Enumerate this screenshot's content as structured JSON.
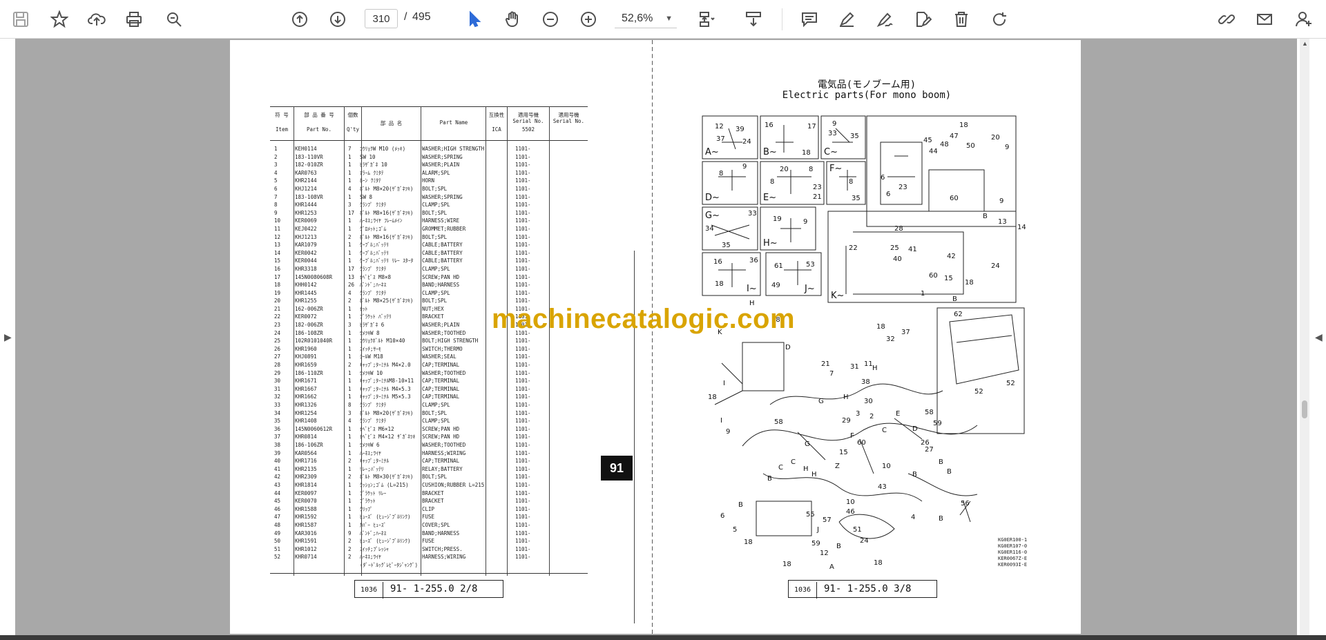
{
  "toolbar": {
    "page_current": "310",
    "page_separator": "/",
    "page_total": "495",
    "zoom": "52,6%"
  },
  "watermark": "machinecatalogic.com",
  "left_page": {
    "badge": "91",
    "footer_code": "1036",
    "footer_text": "91- 1-255.0   2/8",
    "headers": {
      "item_jp": "符 号",
      "item_en": "Item",
      "partno_jp": "部 品 番 号",
      "partno_en": "Part No.",
      "qty_jp": "個数",
      "qty_en": "Q'ty",
      "name_jp": "部 品 名",
      "name_en": "Part Name",
      "ica_jp": "互換性",
      "ica_en": "ICA",
      "serial1_jp": "適用号機",
      "serial1_en": "Serial No.",
      "serial1_val": "5502",
      "serial2_jp": "適用号機",
      "serial2_en": "Serial No."
    },
    "rows": [
      [
        "1",
        "KEH0114",
        "7",
        "ｺｳﾘｮｸW M10 (ﾒｯｷ)",
        "WASHER;HIGH STRENGTH",
        "1101-"
      ],
      [
        "2",
        "183-110VR",
        "1",
        "SW 10",
        "WASHER;SPRING",
        "1101-"
      ],
      [
        "3",
        "182-010ZR",
        "1",
        "ﾋﾗｻﾞｶﾞﾈ 10",
        "WASHER;PLAIN",
        "1101-"
      ],
      [
        "4",
        "KAR0763",
        "1",
        "ｱﾗｰﾑ ｸﾐﾀﾃ",
        "ALARM;SPL",
        "1101-"
      ],
      [
        "5",
        "KHR2144",
        "1",
        "ﾎｰﾝ ｸﾐﾀﾃ",
        "HORN",
        "1101-"
      ],
      [
        "6",
        "KHJ1214",
        "4",
        "ﾎﾞﾙﾄ M8×20(ｻﾞｶﾞﾈﾂｷ)",
        "BOLT;SPL",
        "1101-"
      ],
      [
        "7",
        "183-108VR",
        "1",
        "SW 8",
        "WASHER;SPRING",
        "1101-"
      ],
      [
        "8",
        "KHR1444",
        "3",
        "ｸﾗﾝﾌﾟ ｸﾐﾀﾃ",
        "CLAMP;SPL",
        "1101-"
      ],
      [
        "9",
        "KHR1253",
        "17",
        "ﾎﾞﾙﾄ M8×16(ｻﾞｶﾞﾈﾂｷ)",
        "BOLT;SPL",
        "1101-"
      ],
      [
        "10",
        "KER0069",
        "1",
        "ﾊｰﾈｽ;ﾜｲﾔ ﾌﾚｰﾑﾒｲﾝ",
        "HARNESS;WIRE",
        "1101-"
      ],
      [
        "11",
        "KEJ0422",
        "1",
        "ｸﾞﾛﾒｯﾄ;ｺﾞﾑ",
        "GROMMET;RUBBER",
        "1101-"
      ],
      [
        "12",
        "KHJ1213",
        "2",
        "ﾎﾞﾙﾄ M8×16(ｻﾞｶﾞﾈﾂｷ)",
        "BOLT;SPL",
        "1101-"
      ],
      [
        "13",
        "KAR1079",
        "1",
        "ｹｰﾌﾞﾙ;ﾊﾞｯﾃﾘ",
        "CABLE;BATTERY",
        "1101-"
      ],
      [
        "14",
        "KER0042",
        "1",
        "ｹｰﾌﾞﾙ;ﾊﾞｯﾃﾘ",
        "CABLE;BATTERY",
        "1101-"
      ],
      [
        "15",
        "KER0044",
        "1",
        "ｹｰﾌﾞﾙ;ﾊﾞｯﾃﾘ ﾘﾚｰ ｽﾀｰﾀ",
        "CABLE;BATTERY",
        "1101-"
      ],
      [
        "16",
        "KHR3318",
        "17",
        "ｸﾗﾝﾌﾟ ｸﾐﾀﾃ",
        "CLAMP;SPL",
        "1101-"
      ],
      [
        "17",
        "145N0080608R",
        "13",
        "ﾅﾍﾞﾋﾞｽ M8×8",
        "SCREW;PAN HD",
        "1101-"
      ],
      [
        "18",
        "KHH0142",
        "26",
        "ﾊﾞﾝﾄﾞ;ﾊｰﾈｽ",
        "BAND;HARNESS",
        "1101-"
      ],
      [
        "19",
        "KHR1445",
        "4",
        "ｸﾗﾝﾌﾟ ｸﾐﾀﾃ",
        "CLAMP;SPL",
        "1101-"
      ],
      [
        "20",
        "KHR1255",
        "2",
        "ﾎﾞﾙﾄ M8×25(ｻﾞｶﾞﾈﾂｷ)",
        "BOLT;SPL",
        "1101-"
      ],
      [
        "21",
        "162-006ZR",
        "1",
        "ﾅｯﾄ",
        "NUT;HEX",
        "1101-"
      ],
      [
        "22",
        "KER0072",
        "1",
        "ﾌﾞﾗｹｯﾄ ﾊﾞｯﾃﾘ",
        "BRACKET",
        "1101-"
      ],
      [
        "23",
        "182-006ZR",
        "3",
        "ﾋﾗｻﾞｶﾞﾈ 6",
        "WASHER;PLAIN",
        "1101-"
      ],
      [
        "24",
        "186-108ZR",
        "1",
        "ﾂﾒﾂｷW 8",
        "WASHER;TOOTHED",
        "1101-"
      ],
      [
        "25",
        "102R0101040R",
        "1",
        "ｺｳﾘｮｸﾎﾞﾙﾄ M10×40",
        "BOLT;HIGH STRENGTH",
        "1101-"
      ],
      [
        "26",
        "KHR1960",
        "1",
        "ｽｲｯﾁ;ｻｰﾓ",
        "SWITCH;THERMO",
        "1101-"
      ],
      [
        "27",
        "KHJ0891",
        "1",
        "ｼｰﾙW M18",
        "WASHER;SEAL",
        "1101-"
      ],
      [
        "28",
        "KHR1659",
        "2",
        "ｷｬｯﾌﾟ;ﾀｰﾐﾅﾙ M4×2.0",
        "CAP;TERMINAL",
        "1101-"
      ],
      [
        "29",
        "186-110ZR",
        "1",
        "ﾂﾒﾂｷW 10",
        "WASHER;TOOTHED",
        "1101-"
      ],
      [
        "30",
        "KHR1671",
        "1",
        "ｷｬｯﾌﾟ;ﾀｰﾐﾅﾙM8-10×11",
        "CAP;TERMINAL",
        "1101-"
      ],
      [
        "31",
        "KHR1667",
        "1",
        "ｷｬｯﾌﾟ;ﾀｰﾐﾅﾙ M4×5.3",
        "CAP;TERMINAL",
        "1101-"
      ],
      [
        "32",
        "KHR1662",
        "1",
        "ｷｬｯﾌﾟ;ﾀｰﾐﾅﾙ M5×5.3",
        "CAP;TERMINAL",
        "1101-"
      ],
      [
        "33",
        "KHR1326",
        "8",
        "ｸﾗﾝﾌﾟ ｸﾐﾀﾃ",
        "CLAMP;SPL",
        "1101-"
      ],
      [
        "34",
        "KHR1254",
        "3",
        "ﾎﾞﾙﾄ M8×20(ｻﾞｶﾞﾈﾂｷ)",
        "BOLT;SPL",
        "1101-"
      ],
      [
        "35",
        "KHR1408",
        "4",
        "ｸﾗﾝﾌﾟ ｸﾐﾀﾃ",
        "CLAMP;SPL",
        "1101-"
      ],
      [
        "36",
        "145N0060612R",
        "1",
        "ﾅﾍﾞﾋﾞｽ M6×12",
        "SCREW;PAN HD",
        "1101-"
      ],
      [
        "37",
        "KHR0814",
        "1",
        "ﾅﾍﾞﾋﾞｽ M4×12 ｻﾞｶﾞﾈﾂｷ",
        "SCREW;PAN HD",
        "1101-"
      ],
      [
        "38",
        "186-106ZR",
        "1",
        "ﾂﾒﾂｷW 6",
        "WASHER;TOOTHED",
        "1101-"
      ],
      [
        "39",
        "KAR0564",
        "1",
        "ﾊｰﾈｽ;ﾜｲﾔ",
        "HARNESS;WIRING",
        "1101-"
      ],
      [
        "40",
        "KHR1716",
        "2",
        "ｷｬｯﾌﾟ;ﾀｰﾐﾅﾙ",
        "CAP;TERMINAL",
        "1101-"
      ],
      [
        "41",
        "KHR2135",
        "1",
        "ﾘﾚｰ;ﾊﾞｯﾃﾘ",
        "RELAY;BATTERY",
        "1101-"
      ],
      [
        "42",
        "KHR2309",
        "2",
        "ﾎﾞﾙﾄ M8×30(ｻﾞｶﾞﾈﾂｷ)",
        "BOLT;SPL",
        "1101-"
      ],
      [
        "43",
        "KHR1814",
        "1",
        "ｸｯｼｮﾝ;ｺﾞﾑ (L=215)",
        "CUSHION;RUBBER L=215",
        "1101-"
      ],
      [
        "44",
        "KER0097",
        "1",
        "ﾌﾞﾗｹｯﾄ ﾘﾚｰ",
        "BRACKET",
        "1101-"
      ],
      [
        "45",
        "KER0070",
        "1",
        "ﾌﾞﾗｹｯﾄ",
        "BRACKET",
        "1101-"
      ],
      [
        "46",
        "KHR1588",
        "1",
        "ｸﾘｯﾌﾟ",
        "CLIP",
        "1101-"
      ],
      [
        "47",
        "KHR1592",
        "1",
        "ﾋｭｰｽﾞ (ﾋｭｰｼﾞﾌﾞﾙﾘﾝｸ)",
        "FUSE",
        "1101-"
      ],
      [
        "48",
        "KHR1587",
        "1",
        "ｶﾊﾞｰ ﾋｭｰｽﾞ",
        "COVER;SPL",
        "1101-"
      ],
      [
        "49",
        "KAR3016",
        "9",
        "ﾊﾞﾝﾄﾞ;ﾊｰﾈｽ",
        "BAND;HARNESS",
        "1101-"
      ],
      [
        "50",
        "KHR1591",
        "2",
        "ﾋｭｰｽﾞ (ﾋｭｰｼﾞﾌﾞﾙﾘﾝｸ)",
        "FUSE",
        "1101-"
      ],
      [
        "51",
        "KHR1012",
        "2",
        "ｽｲｯﾁ;ﾌﾟﾚｯｼｬ",
        "SWITCH;PRESS.",
        "1101-"
      ],
      [
        "52",
        "KHR0714",
        "2",
        "ﾊｰﾈｽ;ﾜｲﾔ",
        "HARNESS;WIRING",
        "1101-"
      ],
      [
        "",
        "",
        "",
        "(ﾀﾞｰﾄﾞﾙｯｸﾞﾚﾋﾞｰﾀｼﾞｬﾝｸﾞ)",
        "",
        ""
      ]
    ]
  },
  "right_page": {
    "title_jp": "電気品(モノブーム用)",
    "title_en": "Electric parts(For mono boom)",
    "footer_code": "1036",
    "footer_text": "91- 1-255.0   3/8",
    "codes": [
      "KG0ER100-1",
      "KG0ER107-0",
      "KG0ER116-0",
      "KER0067Z-E",
      "KER0093I-E"
    ],
    "views": [
      "A~",
      "B~",
      "C~",
      "D~",
      "E~",
      "F~",
      "G~",
      "H~",
      "I~",
      "J~",
      "K~"
    ]
  }
}
